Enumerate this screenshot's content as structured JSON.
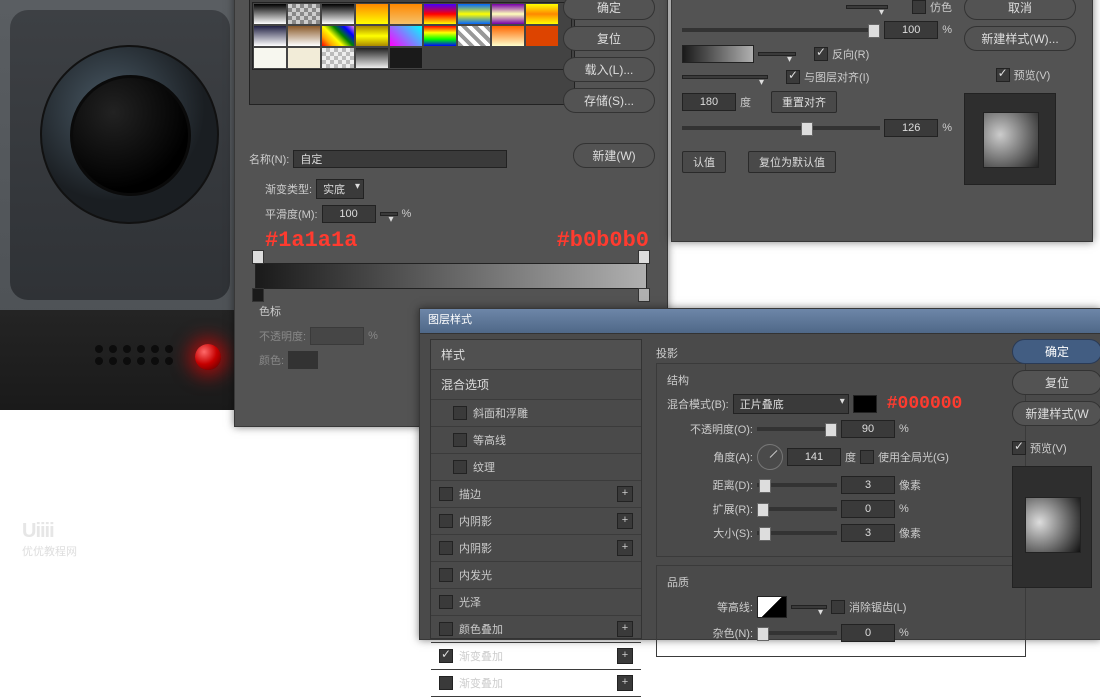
{
  "watermark": {
    "logo": "Uiiii",
    "sub": "优优教程网"
  },
  "redlabels": {
    "left": "#1a1a1a",
    "right": "#b0b0b0",
    "shadow": "#000000"
  },
  "gradient_editor": {
    "buttons": {
      "ok": "确定",
      "reset": "复位",
      "load": "载入(L)...",
      "save": "存储(S)...",
      "new": "新建(W)"
    },
    "name_label": "名称(N):",
    "name_value": "自定",
    "grad_type_label": "渐变类型:",
    "grad_type_value": "实底",
    "smooth_label": "平滑度(M):",
    "smooth_value": "100",
    "smooth_unit": "%",
    "stops_label": "色标",
    "opacity_label": "不透明度:",
    "opacity_unit": "%",
    "color_label": "颜色:"
  },
  "gradient_overlay": {
    "dither_label": "仿色",
    "dither": false,
    "opacity_value": "100",
    "opacity_unit": "%",
    "reverse_label": "反向(R)",
    "reverse": true,
    "align_label": "与图层对齐(I)",
    "align": true,
    "angle_value": "180",
    "angle_unit": "度",
    "reset_align": "重置对齐",
    "scale_value": "126",
    "scale_unit": "%",
    "make_default": "认值",
    "reset_default": "复位为默认值",
    "buttons": {
      "cancel": "取消",
      "new_style": "新建样式(W)..."
    },
    "preview_label": "预览(V)",
    "preview": true
  },
  "layer_style": {
    "title": "图层样式",
    "styles_header": "样式",
    "blend_options": "混合选项",
    "items": [
      {
        "label": "斜面和浮雕",
        "checked": false,
        "plus": false
      },
      {
        "label": "等高线",
        "checked": false,
        "plus": false
      },
      {
        "label": "纹理",
        "checked": false,
        "plus": false
      },
      {
        "label": "描边",
        "checked": false,
        "plus": true
      },
      {
        "label": "内阴影",
        "checked": false,
        "plus": true
      },
      {
        "label": "内阴影",
        "checked": false,
        "plus": true
      },
      {
        "label": "内发光",
        "checked": false,
        "plus": false
      },
      {
        "label": "光泽",
        "checked": false,
        "plus": false
      },
      {
        "label": "颜色叠加",
        "checked": false,
        "plus": true
      },
      {
        "label": "渐变叠加",
        "checked": true,
        "plus": true
      },
      {
        "label": "渐变叠加",
        "checked": false,
        "plus": true
      }
    ],
    "shadow": {
      "section": "投影",
      "structure": "结构",
      "blend_mode_label": "混合模式(B):",
      "blend_mode_value": "正片叠底",
      "opacity_label": "不透明度(O):",
      "opacity_value": "90",
      "opacity_unit": "%",
      "angle_label": "角度(A):",
      "angle_value": "141",
      "angle_unit": "度",
      "global_light_label": "使用全局光(G)",
      "global_light": false,
      "distance_label": "距离(D):",
      "distance_value": "3",
      "distance_unit": "像素",
      "spread_label": "扩展(R):",
      "spread_value": "0",
      "spread_unit": "%",
      "size_label": "大小(S):",
      "size_value": "3",
      "size_unit": "像素",
      "quality": "品质",
      "contour_label": "等高线:",
      "antialias_label": "消除锯齿(L)",
      "antialias": false,
      "noise_label": "杂色(N):",
      "noise_value": "0",
      "noise_unit": "%"
    },
    "right": {
      "ok": "确定",
      "reset": "复位",
      "new_style": "新建样式(W",
      "preview_label": "预览(V)",
      "preview": true
    }
  }
}
